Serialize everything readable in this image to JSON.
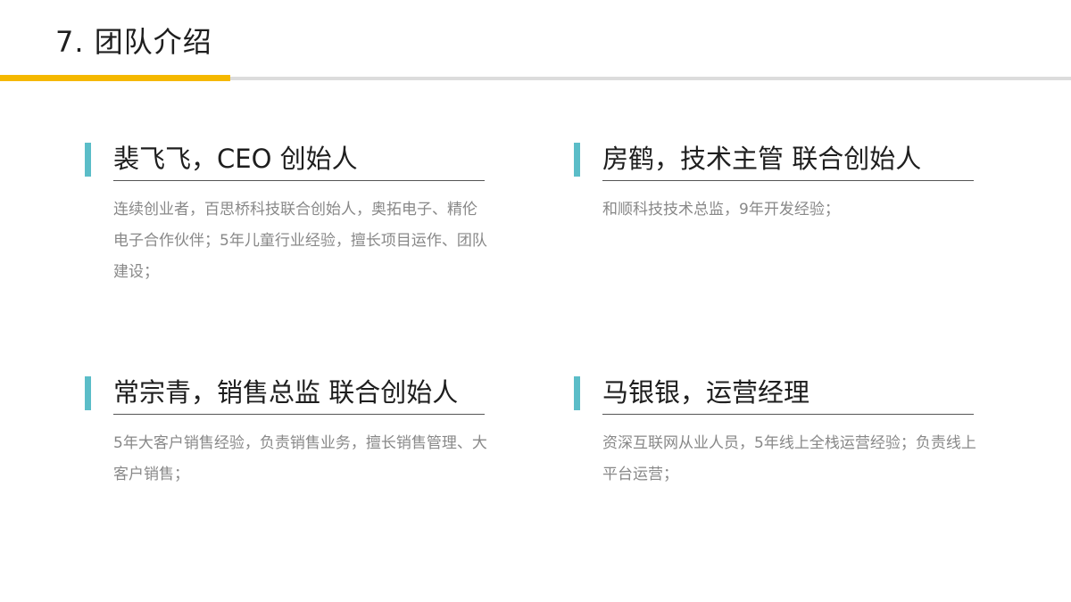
{
  "title": "7. 团队介绍",
  "colors": {
    "accent_yellow": "#f5b800",
    "accent_teal": "#5bbdc8",
    "rule_gray": "#dcdcdc"
  },
  "members": [
    {
      "name": "裴飞飞，CEO 创始人",
      "desc": "连续创业者，百思桥科技联合创始人，奥拓电子、精伦电子合作伙伴；5年儿童行业经验，擅长项目运作、团队建设；"
    },
    {
      "name": "房鹤，技术主管 联合创始人",
      "desc": "和顺科技技术总监，9年开发经验；"
    },
    {
      "name": "常宗青，销售总监 联合创始人",
      "desc": "5年大客户销售经验，负责销售业务，擅长销售管理、大客户销售；"
    },
    {
      "name": "马银银，运营经理",
      "desc": "资深互联网从业人员，5年线上全栈运营经验；负责线上平台运营；"
    }
  ]
}
